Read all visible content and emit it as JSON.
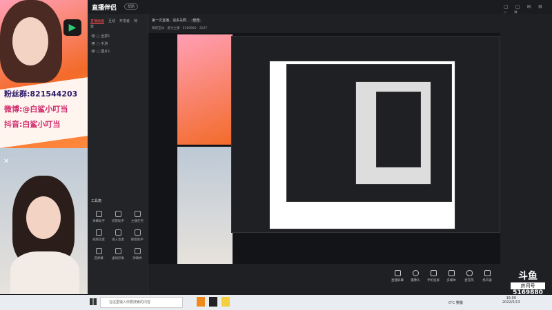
{
  "app": {
    "name": "直播伴侣",
    "version_badge": "帮助"
  },
  "promo": {
    "fan_group": "粉丝群:821544203",
    "weibo": "微博:@白鲨小叮当",
    "douyin": "抖音:白鲨小叮当"
  },
  "sidebar": {
    "tabs": [
      "直播画面",
      "互动",
      "开发者",
      "特效"
    ],
    "scenes": [
      "全屏1",
      "手游",
      "图片1"
    ],
    "tools_title": "工具箱",
    "tools": [
      "弹幕助手",
      "房管助手",
      "主播任务",
      "视频连麦",
      "进入连麦",
      "橱窗助手",
      "选弹幕",
      "虚拟形象",
      "弹幕秀"
    ]
  },
  "header": {
    "title": "第一次直播，请多关照...",
    "edit": "修改",
    "category": "情感互动 · 星光主播",
    "stats": [
      "5169880",
      "2037"
    ]
  },
  "controls": [
    "直播屏幕",
    "摄像头",
    "手机投屏",
    "多媒体",
    "麦克风",
    "扬声器"
  ],
  "overlay": {
    "brand": "斗鱼",
    "room_label": "房间号",
    "room_number": "5169880"
  },
  "taskbar": {
    "search_placeholder": "在这里输入你要搜索的内容",
    "weather": "0°C 雾霾",
    "time": "16:00",
    "date": "2022/5/13"
  },
  "colors": {
    "accent": "#ff4f4f",
    "bg": "#1f2024"
  }
}
